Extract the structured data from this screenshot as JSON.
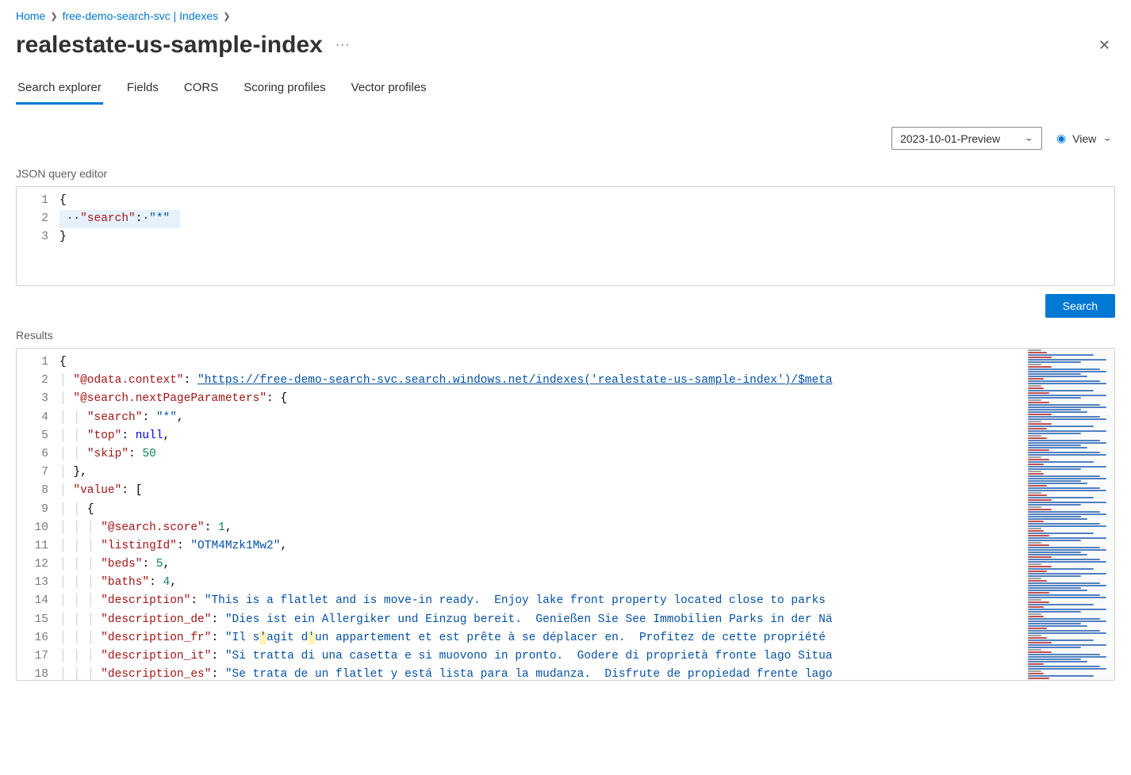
{
  "breadcrumb": {
    "home": "Home",
    "svc": "free-demo-search-svc | Indexes"
  },
  "title": "realestate-us-sample-index",
  "tabs": {
    "search_explorer": "Search explorer",
    "fields": "Fields",
    "cors": "CORS",
    "scoring": "Scoring profiles",
    "vector": "Vector profiles"
  },
  "toolbar": {
    "api_version": "2023-10-01-Preview",
    "view_label": "View"
  },
  "labels": {
    "query_editor": "JSON query editor",
    "results": "Results",
    "search_btn": "Search"
  },
  "query": {
    "line1": "{",
    "key": "\"search\"",
    "val": "\"*\"",
    "line3": "}"
  },
  "results": {
    "l1": "{",
    "k_context": "\"@odata.context\"",
    "v_context": "\"https://free-demo-search-svc.search.windows.net/indexes('realestate-us-sample-index')/$meta",
    "k_next": "\"@search.nextPageParameters\"",
    "k_search": "\"search\"",
    "v_search": "\"*\"",
    "k_top": "\"top\"",
    "v_top": "null",
    "k_skip": "\"skip\"",
    "v_skip": "50",
    "k_value": "\"value\"",
    "k_score": "\"@search.score\"",
    "v_score": "1",
    "k_listing": "\"listingId\"",
    "v_listing": "\"OTM4Mzk1Mw2\"",
    "k_beds": "\"beds\"",
    "v_beds": "5",
    "k_baths": "\"baths\"",
    "v_baths": "4",
    "k_desc": "\"description\"",
    "v_desc": "\"This is a flatlet and is move-in ready.  Enjoy lake front property located close to parks",
    "k_desc_de": "\"description_de\"",
    "v_desc_de": "\"Dies ist ein Allergiker und Einzug bereit.  Genießen Sie See Immobilien Parks in der Nä",
    "k_desc_fr": "\"description_fr\"",
    "v_desc_fr_a": "\"Il s",
    "v_desc_fr_b": "agit d",
    "v_desc_fr_c": "un appartement et est prête à se déplacer en.  Profitez de cette propriété",
    "k_desc_it": "\"description_it\"",
    "v_desc_it": "\"Si tratta di una casetta e si muovono in pronto.  Godere di proprietà fronte lago Situa",
    "k_desc_es": "\"description_es\"",
    "v_desc_es": "\"Se trata de un flatlet y está lista para la mudanza.  Disfrute de propiedad frente lago"
  }
}
